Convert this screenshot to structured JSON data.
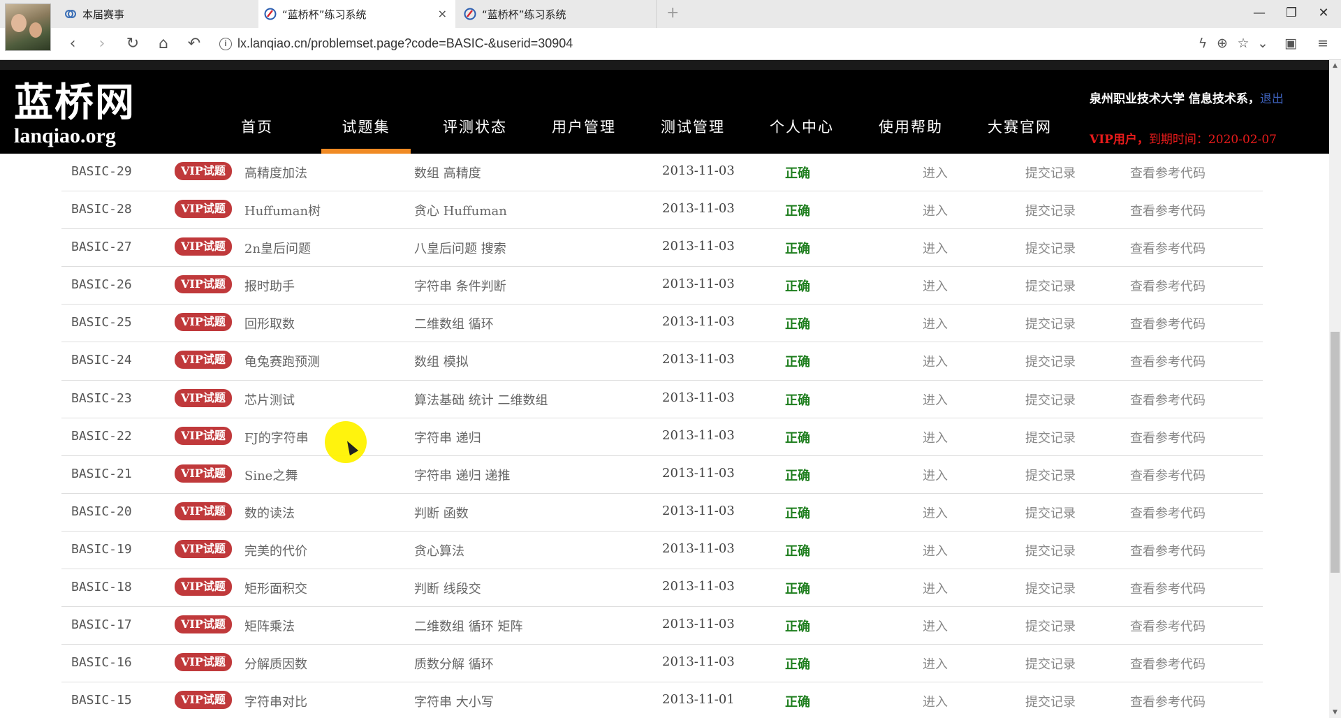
{
  "browser": {
    "tabs": [
      {
        "title": "本届赛事",
        "active": false
      },
      {
        "title": "“蓝桥杯”练习系统",
        "active": true
      },
      {
        "title": "“蓝桥杯”练习系统",
        "active": false
      }
    ],
    "new_tab_glyph": "+",
    "close_glyph": "×",
    "url": "lx.lanqiao.cn/problemset.page?code=BASIC-&userid=30904",
    "window_controls": [
      "—",
      "❐",
      "✕"
    ]
  },
  "site": {
    "logo_cn": "蓝桥网",
    "logo_en": "lanqiao.org",
    "nav": [
      {
        "label": "首页",
        "active": false
      },
      {
        "label": "试题集",
        "active": true
      },
      {
        "label": "评测状态",
        "active": false
      },
      {
        "label": "用户管理",
        "active": false
      },
      {
        "label": "测试管理",
        "active": false
      },
      {
        "label": "个人中心",
        "active": false
      },
      {
        "label": "使用帮助",
        "active": false
      },
      {
        "label": "大赛官网",
        "active": false
      }
    ],
    "user": {
      "org": "泉州职业技术大学 信息技术系，",
      "logout": "退出",
      "vip_label": "VIP用户，",
      "expiry_label": "到期时间：2020-02-07"
    }
  },
  "problems": {
    "badge": "VIP试题",
    "enter_label": "进入",
    "submit_label": "提交记录",
    "ref_label": "查看参考代码",
    "rows": [
      {
        "id": "BASIC-29",
        "name": "高精度加法",
        "tags": "数组 高精度",
        "date": "2013-11-03",
        "status": "正确"
      },
      {
        "id": "BASIC-28",
        "name": "Huffuman树",
        "tags": "贪心 Huffuman",
        "date": "2013-11-03",
        "status": "正确"
      },
      {
        "id": "BASIC-27",
        "name": "2n皇后问题",
        "tags": "八皇后问题 搜索",
        "date": "2013-11-03",
        "status": "正确"
      },
      {
        "id": "BASIC-26",
        "name": "报时助手",
        "tags": "字符串 条件判断",
        "date": "2013-11-03",
        "status": "正确"
      },
      {
        "id": "BASIC-25",
        "name": "回形取数",
        "tags": "二维数组 循环",
        "date": "2013-11-03",
        "status": "正确"
      },
      {
        "id": "BASIC-24",
        "name": "龟兔赛跑预测",
        "tags": "数组 模拟",
        "date": "2013-11-03",
        "status": "正确"
      },
      {
        "id": "BASIC-23",
        "name": "芯片测试",
        "tags": "算法基础 统计 二维数组",
        "date": "2013-11-03",
        "status": "正确"
      },
      {
        "id": "BASIC-22",
        "name": "FJ的字符串",
        "tags": "字符串 递归",
        "date": "2013-11-03",
        "status": "正确"
      },
      {
        "id": "BASIC-21",
        "name": "Sine之舞",
        "tags": "字符串 递归 递推",
        "date": "2013-11-03",
        "status": "正确"
      },
      {
        "id": "BASIC-20",
        "name": "数的读法",
        "tags": "判断 函数",
        "date": "2013-11-03",
        "status": "正确"
      },
      {
        "id": "BASIC-19",
        "name": "完美的代价",
        "tags": "贪心算法",
        "date": "2013-11-03",
        "status": "正确"
      },
      {
        "id": "BASIC-18",
        "name": "矩形面积交",
        "tags": "判断 线段交",
        "date": "2013-11-03",
        "status": "正确"
      },
      {
        "id": "BASIC-17",
        "name": "矩阵乘法",
        "tags": "二维数组 循环 矩阵",
        "date": "2013-11-03",
        "status": "正确"
      },
      {
        "id": "BASIC-16",
        "name": "分解质因数",
        "tags": "质数分解 循环",
        "date": "2013-11-03",
        "status": "正确"
      },
      {
        "id": "BASIC-15",
        "name": "字符串对比",
        "tags": "字符串 大小写",
        "date": "2013-11-01",
        "status": "正确"
      }
    ]
  },
  "colors": {
    "badge": "#c0393b",
    "status_ok": "#1e7e1e",
    "nav_active": "#f08a24",
    "vip": "#e81b1b",
    "logout": "#3c5fb8"
  }
}
